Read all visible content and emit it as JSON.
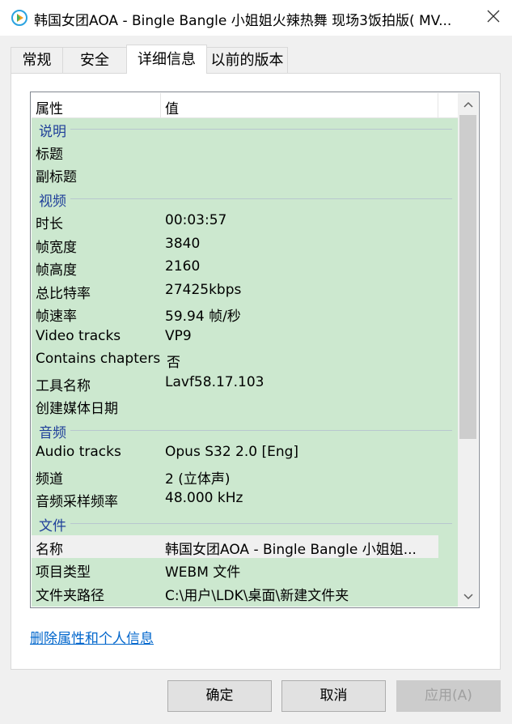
{
  "window": {
    "title": "韩国女团AOA - Bingle Bangle 小姐姐火辣热舞 现场3饭拍版( MV...",
    "app_icon": "media-player-icon",
    "close_icon": "close-icon"
  },
  "tabs": [
    {
      "label": "常规",
      "active": false
    },
    {
      "label": "安全",
      "active": false
    },
    {
      "label": "详细信息",
      "active": true
    },
    {
      "label": "以前的版本",
      "active": false
    }
  ],
  "table": {
    "header": {
      "property": "属性",
      "value": "值"
    },
    "groups": {
      "description": "说明",
      "video": "视频",
      "audio": "音频",
      "file": "文件"
    },
    "rows": {
      "title": {
        "name": "标题",
        "value": ""
      },
      "subtitle": {
        "name": "副标题",
        "value": ""
      },
      "length": {
        "name": "时长",
        "value": "00:03:57"
      },
      "frame_width": {
        "name": "帧宽度",
        "value": "3840"
      },
      "frame_height": {
        "name": "帧高度",
        "value": "2160"
      },
      "total_bitrate": {
        "name": "总比特率",
        "value": "27425kbps"
      },
      "frame_rate": {
        "name": "帧速率",
        "value": "59.94 帧/秒"
      },
      "video_tracks": {
        "name": "Video tracks",
        "value": "VP9"
      },
      "contains_chapters": {
        "name": "Contains chapters",
        "value": "否"
      },
      "encoder": {
        "name": "工具名称",
        "value": "Lavf58.17.103"
      },
      "media_created": {
        "name": "创建媒体日期",
        "value": ""
      },
      "audio_tracks": {
        "name": "Audio tracks",
        "value": "Opus S32 2.0 [Eng]"
      },
      "channels": {
        "name": "频道",
        "value": "2 (立体声)"
      },
      "sample_rate": {
        "name": "音频采样频率",
        "value": "48.000 kHz"
      },
      "file_name": {
        "name": "名称",
        "value": "韩国女团AOA - Bingle Bangle 小姐姐..."
      },
      "item_type": {
        "name": "项目类型",
        "value": "WEBM 文件"
      },
      "folder_path": {
        "name": "文件夹路径",
        "value": "C:\\用户\\LDK\\桌面\\新建文件夹"
      }
    }
  },
  "link": "删除属性和个人信息",
  "buttons": {
    "ok": "确定",
    "cancel": "取消",
    "apply": "应用(A)"
  },
  "colors": {
    "list_background": "#cce8cf",
    "group_header_text": "#1f3f9a",
    "link": "#0066cc"
  }
}
